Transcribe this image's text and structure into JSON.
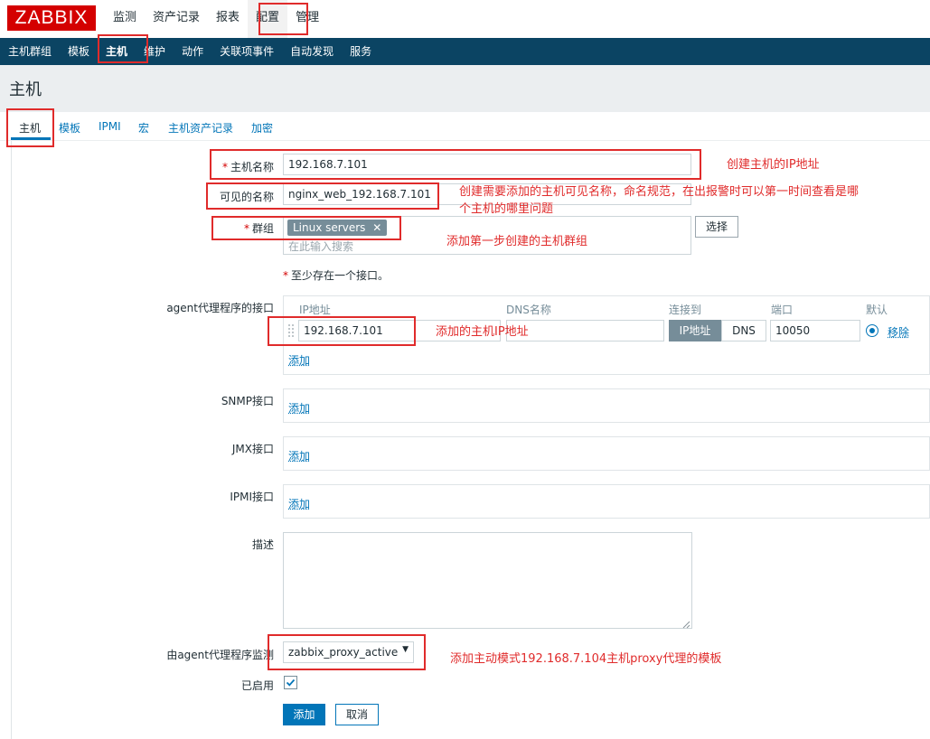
{
  "header": {
    "logo": "ZABBIX",
    "menu": [
      "监测",
      "资产记录",
      "报表",
      "配置",
      "管理"
    ]
  },
  "submenu": [
    "主机群组",
    "模板",
    "主机",
    "维护",
    "动作",
    "关联项事件",
    "自动发现",
    "服务"
  ],
  "page_title": "主机",
  "tabs": [
    "主机",
    "模板",
    "IPMI",
    "宏",
    "主机资产记录",
    "加密"
  ],
  "form": {
    "host_name_label": "主机名称",
    "host_name_value": "192.168.7.101",
    "visible_name_label": "可见的名称",
    "visible_name_value": "nginx_web_192.168.7.101",
    "groups_label": "群组",
    "group_tag": "Linux servers",
    "group_tag_remove": "✕",
    "groups_placeholder": "在此输入搜索",
    "select_button": "选择",
    "interface_required_note": "至少存在一个接口。",
    "agent_label": "agent代理程序的接口",
    "iface_headers": {
      "ip": "IP地址",
      "dns": "DNS名称",
      "connect": "连接到",
      "port": "端口",
      "default": "默认"
    },
    "agent_ip": "192.168.7.101",
    "agent_dns": "",
    "connect_ip": "IP地址",
    "connect_dns": "DNS",
    "agent_port": "10050",
    "remove_link": "移除",
    "add_link": "添加",
    "snmp_label": "SNMP接口",
    "jmx_label": "JMX接口",
    "ipmi_label": "IPMI接口",
    "description_label": "描述",
    "description_value": "",
    "proxy_label": "由agent代理程序监测",
    "proxy_value": "zabbix_proxy_active",
    "enabled_label": "已启用",
    "enabled": true,
    "submit_button": "添加",
    "cancel_button": "取消"
  },
  "annotations": {
    "host_name": "创建主机的IP地址",
    "visible_name_line1": "创建需要添加的主机可见名称，命名规范，在出报警时可以第一时间查看是哪",
    "visible_name_line2": "个主机的哪里问题",
    "groups": "添加第一步创建的主机群组",
    "agent_ip": "添加的主机IP地址",
    "proxy": "添加主动模式192.168.7.104主机proxy代理的模板"
  },
  "colors": {
    "accent": "#0275b8",
    "nav_bg": "#0b4463",
    "logo_bg": "#d40000",
    "annotation": "#e02b2b"
  }
}
